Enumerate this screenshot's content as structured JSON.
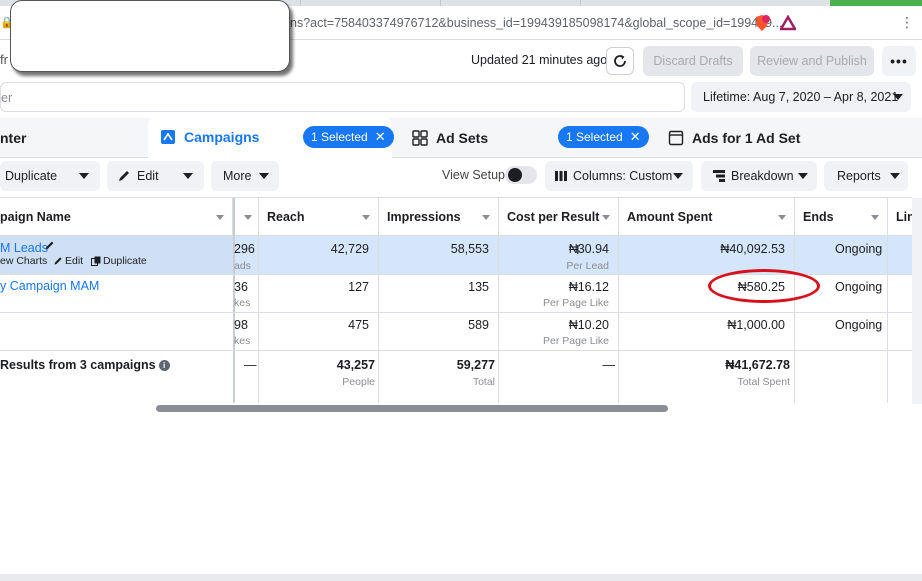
{
  "browser": {
    "url": "ns?act=758403374976712&business_id=199439185098174&global_scope_id=199439..."
  },
  "header": {
    "left_fragment": "fr",
    "updated_text": "Updated 21 minutes ago",
    "discard_label": "Discard Drafts",
    "review_label": "Review and Publish",
    "more_label": "•••"
  },
  "search": {
    "placeholder_fragment": "er"
  },
  "date_range": {
    "label": "Lifetime: Aug 7, 2020 – Apr 8, 2021"
  },
  "level_tabs": {
    "account_fragment": "nter",
    "campaigns": {
      "label": "Campaigns",
      "selected": "1 Selected"
    },
    "adsets": {
      "label": "Ad Sets",
      "selected": "1 Selected"
    },
    "ads": {
      "label": "Ads for 1 Ad Set"
    }
  },
  "toolbar": {
    "duplicate": "Duplicate",
    "edit": "Edit",
    "more": "More",
    "view_setup": "View Setup",
    "columns": "Columns: Custom",
    "breakdown": "Breakdown",
    "reports": "Reports"
  },
  "table": {
    "headers": {
      "name": "paign Name",
      "reach": "Reach",
      "impressions": "Impressions",
      "cpr": "Cost per Result",
      "spent": "Amount Spent",
      "ends": "Ends",
      "link": "Lin"
    },
    "rows": [
      {
        "name": "M Leads",
        "actions": {
          "view_charts": "ew Charts",
          "edit": "Edit",
          "duplicate": "Duplicate"
        },
        "results": "296",
        "results_sub": "ads",
        "reach": "42,729",
        "impressions": "58,553",
        "cpr": "₦30.94",
        "cpr_sub": "Per Lead",
        "spent": "₦40,092.53",
        "ends": "Ongoing"
      },
      {
        "name": "y Campaign MAM",
        "results": "36",
        "results_sub": "kes",
        "reach": "127",
        "impressions": "135",
        "cpr": "₦16.12",
        "cpr_sub": "Per Page Like",
        "spent": "₦580.25",
        "ends": "Ongoing"
      },
      {
        "name": "",
        "results": "98",
        "results_sub": "kes",
        "reach": "475",
        "impressions": "589",
        "cpr": "₦10.20",
        "cpr_sub": "Per Page Like",
        "spent": "₦1,000.00",
        "ends": "Ongoing"
      }
    ],
    "totals": {
      "label": "Results from 3 campaigns",
      "results": "—",
      "reach": "43,257",
      "reach_sub": "People",
      "impressions": "59,277",
      "impressions_sub": "Total",
      "cpr": "—",
      "spent": "₦41,672.78",
      "spent_sub": "Total Spent"
    }
  },
  "colors": {
    "accent": "#1877f2",
    "selected_row": "#d6e6fa",
    "annotation": "#d6111b"
  }
}
